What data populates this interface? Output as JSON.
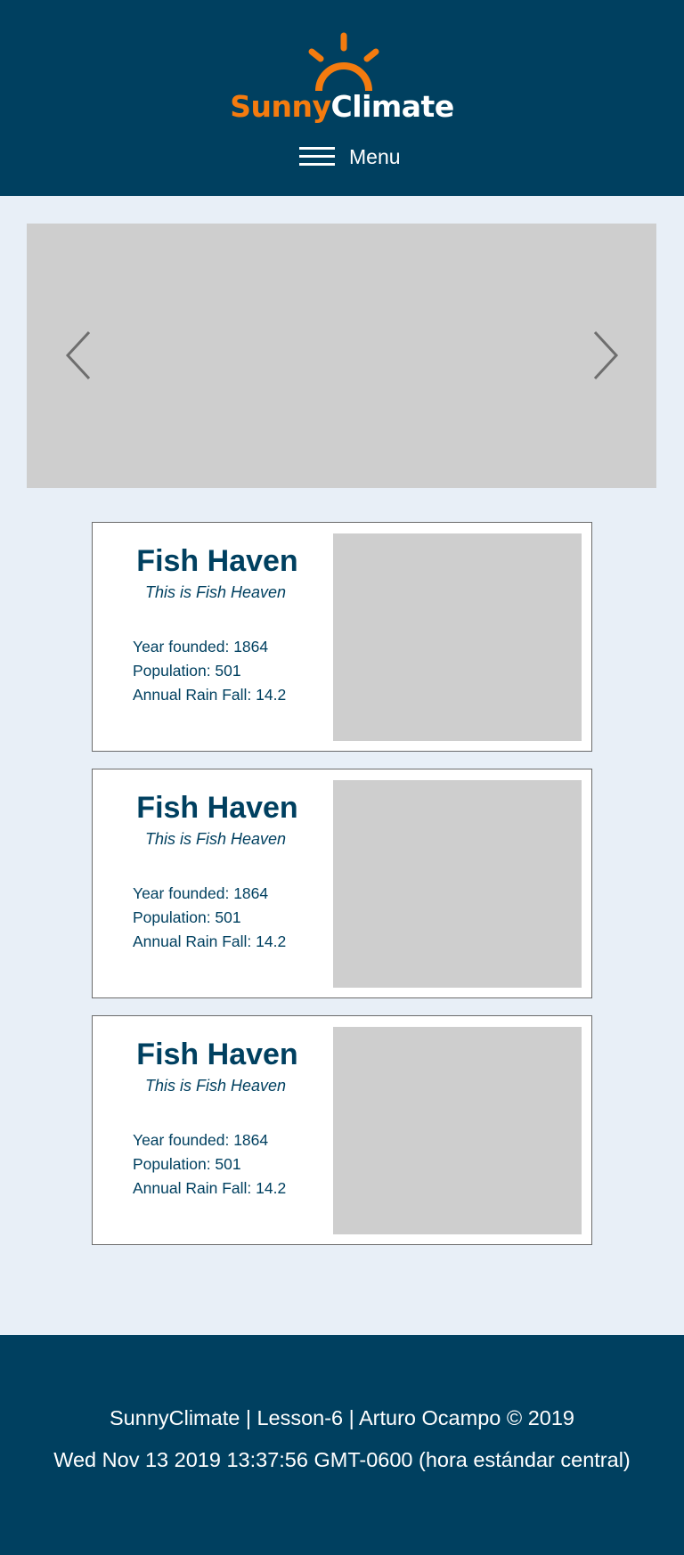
{
  "header": {
    "logo": {
      "word1": "Sunny",
      "word2": "Climate",
      "icon": "sun-icon"
    },
    "menu": {
      "label": "Menu",
      "icon": "hamburger-icon"
    }
  },
  "hero": {
    "prev_icon": "chevron-left-icon",
    "next_icon": "chevron-right-icon"
  },
  "towns": [
    {
      "name": "Fish Haven",
      "motto": "This is Fish Heaven",
      "year_founded": "Year founded: 1864",
      "population": "Population: 501",
      "rainfall": "Annual Rain Fall: 14.2"
    },
    {
      "name": "Fish Haven",
      "motto": "This is Fish Heaven",
      "year_founded": "Year founded: 1864",
      "population": "Population: 501",
      "rainfall": "Annual Rain Fall: 14.2"
    },
    {
      "name": "Fish Haven",
      "motto": "This is Fish Heaven",
      "year_founded": "Year founded: 1864",
      "population": "Population: 501",
      "rainfall": "Annual Rain Fall: 14.2"
    }
  ],
  "footer": {
    "credits": "SunnyClimate | Lesson-6 | Arturo Ocampo © 2019",
    "last_modified": "Wed Nov 13 2019 13:37:56 GMT-0600 (hora estándar central)"
  },
  "colors": {
    "brand_navy": "#004060",
    "brand_orange": "#f47b0f",
    "page_background": "#e8eff7",
    "placeholder_gray": "#cecece"
  }
}
